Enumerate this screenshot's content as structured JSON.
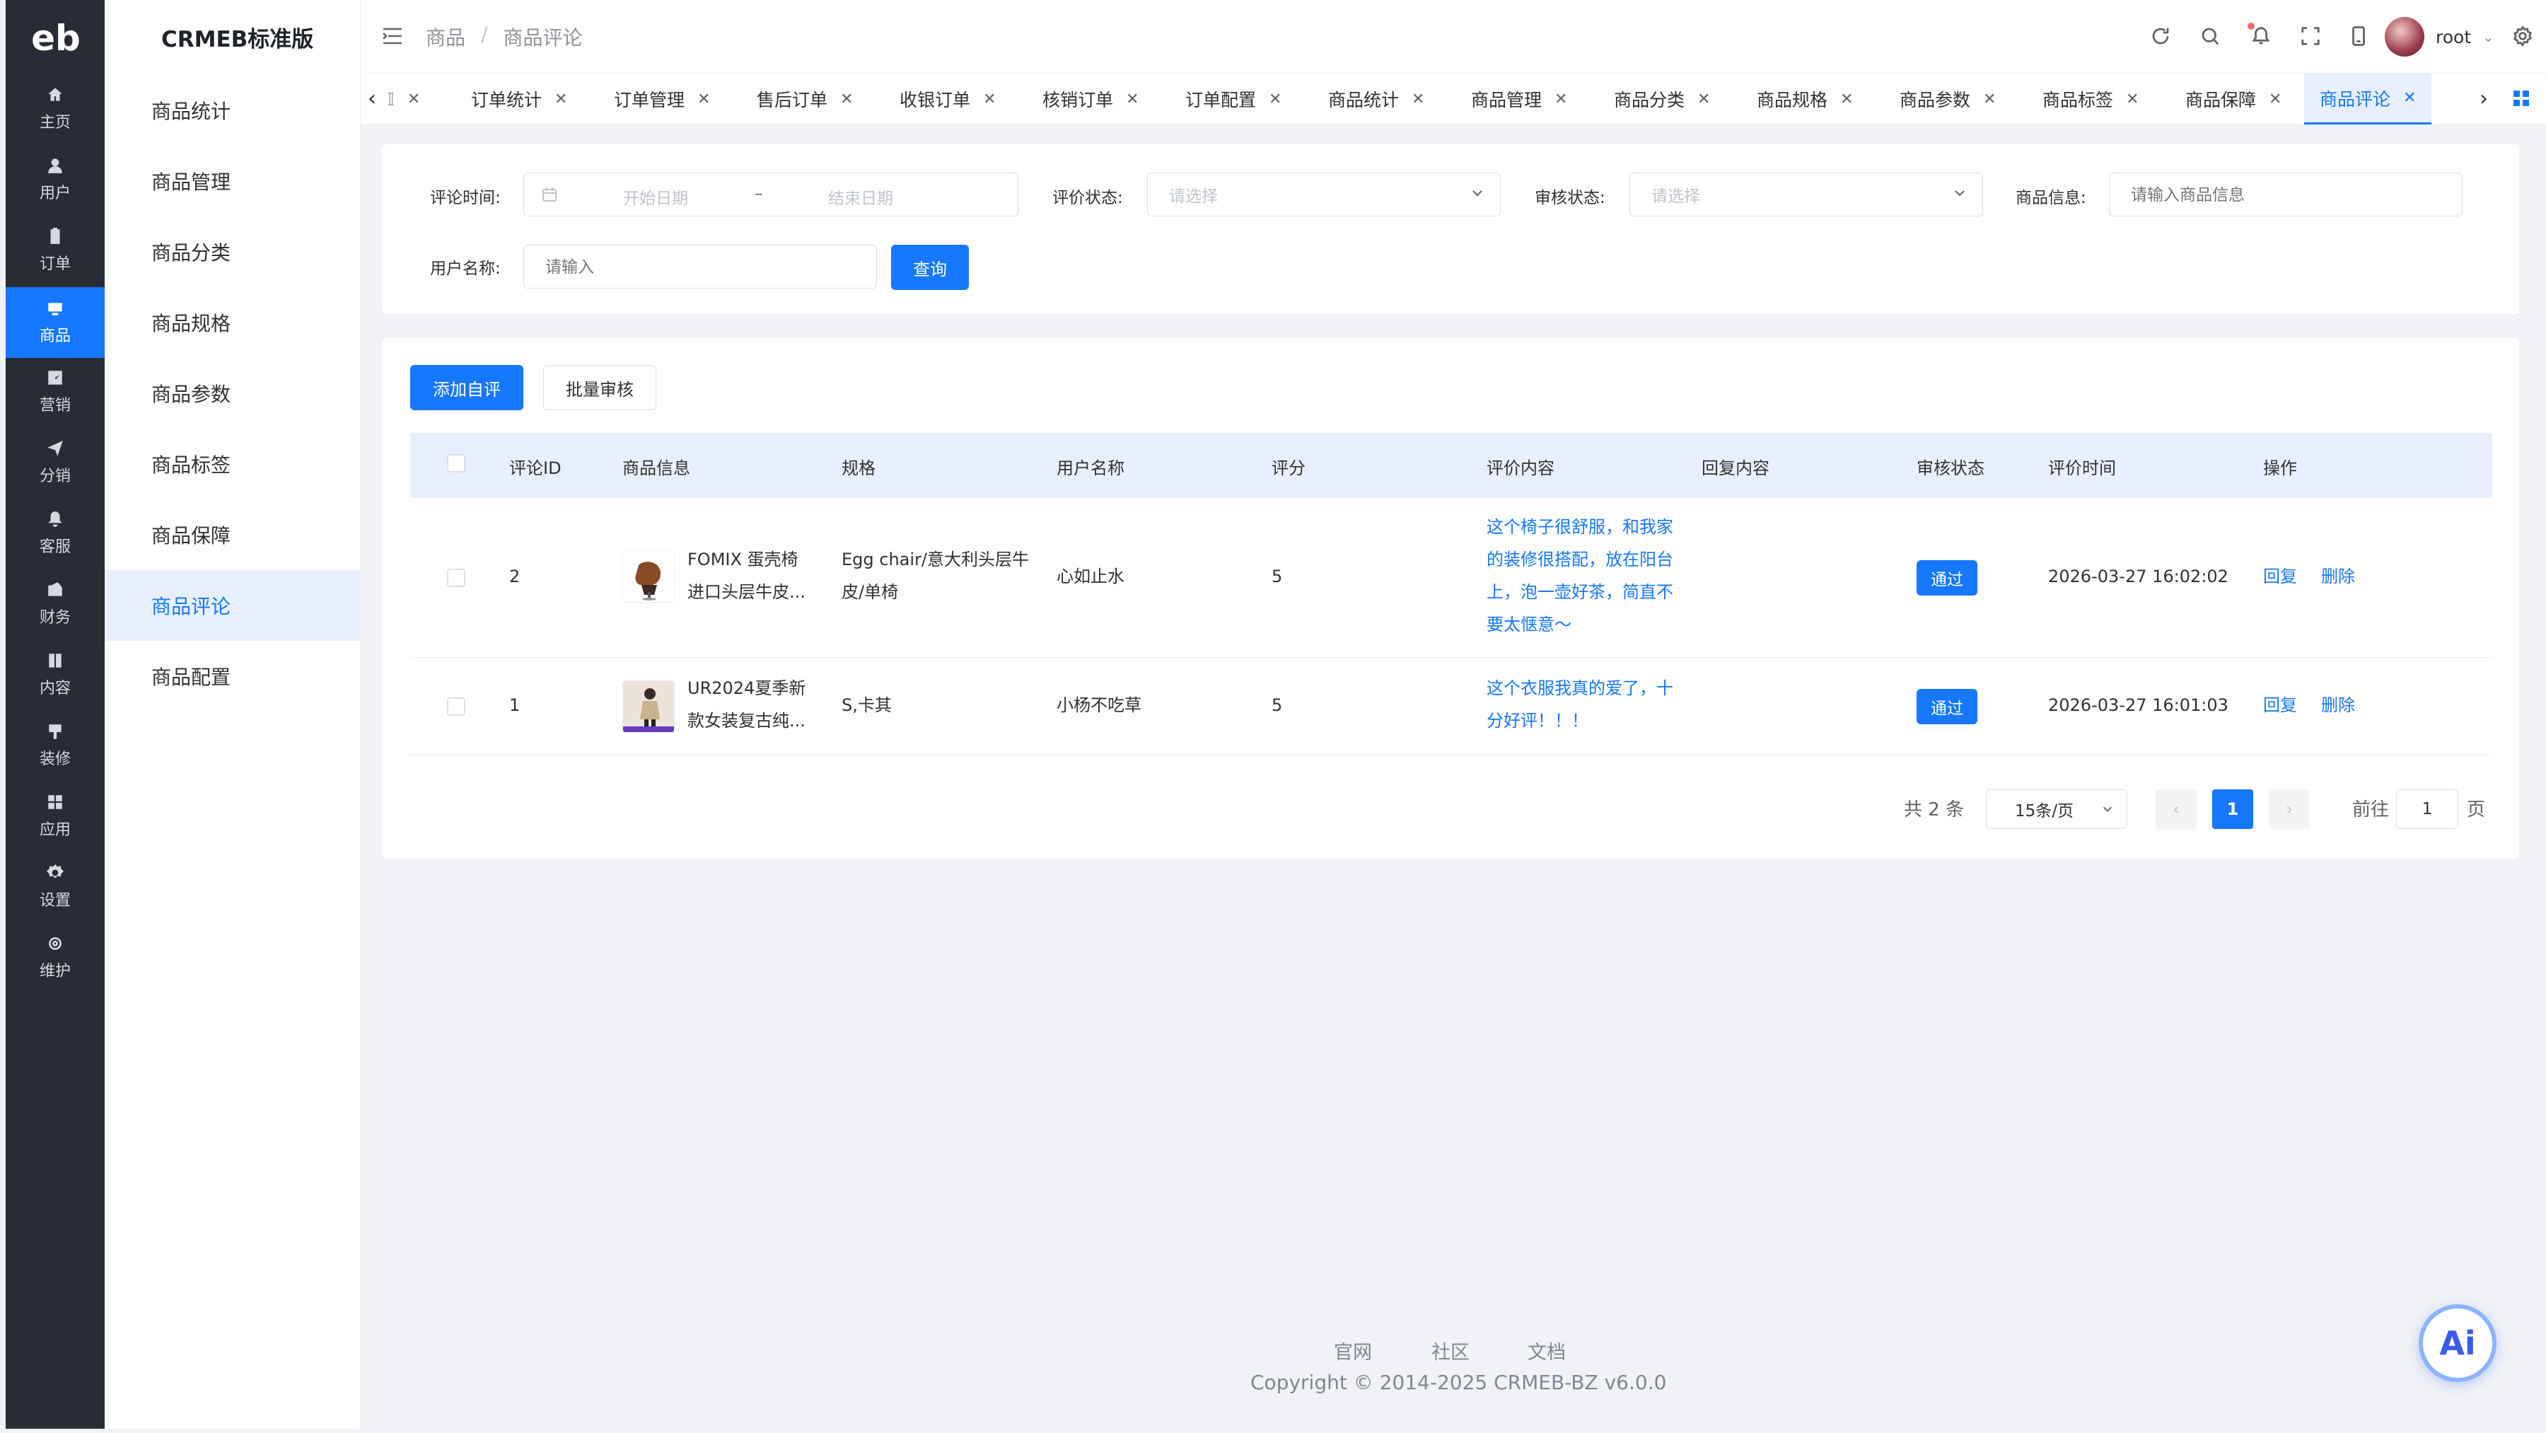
{
  "brand": {
    "logo_text": "eb",
    "title": "CRMEB标准版"
  },
  "rail": [
    {
      "label": "主页",
      "icon": "home-icon"
    },
    {
      "label": "用户",
      "icon": "user-icon"
    },
    {
      "label": "订单",
      "icon": "clipboard-icon"
    },
    {
      "label": "商品",
      "icon": "product-icon",
      "active": true
    },
    {
      "label": "营销",
      "icon": "chart-icon"
    },
    {
      "label": "分销",
      "icon": "send-icon"
    },
    {
      "label": "客服",
      "icon": "bell-icon"
    },
    {
      "label": "财务",
      "icon": "wallet-icon"
    },
    {
      "label": "内容",
      "icon": "book-icon"
    },
    {
      "label": "装修",
      "icon": "brush-icon"
    },
    {
      "label": "应用",
      "icon": "grid-icon"
    },
    {
      "label": "设置",
      "icon": "gear-icon"
    },
    {
      "label": "维护",
      "icon": "cog-icon"
    }
  ],
  "subnav": [
    {
      "label": "商品统计"
    },
    {
      "label": "商品管理"
    },
    {
      "label": "商品分类"
    },
    {
      "label": "商品规格"
    },
    {
      "label": "商品参数"
    },
    {
      "label": "商品标签"
    },
    {
      "label": "商品保障"
    },
    {
      "label": "商品评论",
      "active": true
    },
    {
      "label": "商品配置"
    }
  ],
  "breadcrumb": {
    "parent": "商品",
    "separator": "/",
    "current": "商品评论"
  },
  "header_user": {
    "name": "root"
  },
  "tabs": [
    {
      "label": "订单统计"
    },
    {
      "label": "订单管理"
    },
    {
      "label": "售后订单"
    },
    {
      "label": "收银订单"
    },
    {
      "label": "核销订单"
    },
    {
      "label": "订单配置"
    },
    {
      "label": "商品统计"
    },
    {
      "label": "商品管理"
    },
    {
      "label": "商品分类"
    },
    {
      "label": "商品规格"
    },
    {
      "label": "商品参数"
    },
    {
      "label": "商品标签"
    },
    {
      "label": "商品保障"
    },
    {
      "label": "商品评论",
      "active": true
    }
  ],
  "filters": {
    "time_label": "评论时间:",
    "start_placeholder": "开始日期",
    "range_sep": "–",
    "end_placeholder": "结束日期",
    "review_status_label": "评价状态:",
    "review_status_placeholder": "请选择",
    "audit_status_label": "审核状态:",
    "audit_status_placeholder": "请选择",
    "product_label": "商品信息:",
    "product_placeholder": "请输入商品信息",
    "user_label": "用户名称:",
    "user_placeholder": "请输入",
    "query_button": "查询"
  },
  "actions": {
    "add_button": "添加自评",
    "batch_button": "批量审核"
  },
  "table": {
    "columns": [
      "评论ID",
      "商品信息",
      "规格",
      "用户名称",
      "评分",
      "评价内容",
      "回复内容",
      "审核状态",
      "评价时间",
      "操作"
    ],
    "rows": [
      {
        "id": "2",
        "product_line1": "FOMIX 蛋壳椅",
        "product_line2": "进口头层牛皮...",
        "spec_line1": "Egg chair/意大利头层牛",
        "spec_line2": "皮/单椅",
        "user": "心如止水",
        "score": "5",
        "review": [
          "这个椅子很舒服，和我家",
          "的装修很搭配，放在阳台",
          "上，泡一壶好茶，简直不",
          "要太惬意～"
        ],
        "reply": "",
        "status": "通过",
        "time": "2026-03-27 16:02:02",
        "op_reply": "回复",
        "op_delete": "删除"
      },
      {
        "id": "1",
        "product_line1": "UR2024夏季新",
        "product_line2": "款女装复古纯...",
        "spec_line1": "S,卡其",
        "spec_line2": "",
        "user": "小杨不吃草",
        "score": "5",
        "review": [
          "这个衣服我真的爱了，十",
          "分好评！！！"
        ],
        "reply": "",
        "status": "通过",
        "time": "2026-03-27 16:01:03",
        "op_reply": "回复",
        "op_delete": "删除"
      }
    ]
  },
  "pagination": {
    "total": "共 2 条",
    "page_size": "15条/页",
    "prev": "‹",
    "current": "1",
    "next": "›",
    "goto_label": "前往",
    "goto_value": "1",
    "page_unit": "页"
  },
  "footer": {
    "links": [
      "官网",
      "社区",
      "文档"
    ],
    "copyright": "Copyright © 2014-2025 CRMEB-BZ v6.0.0"
  },
  "ai_button": "Ai",
  "colors": {
    "accent": "#1677ff",
    "sidebar": "#282c34",
    "header_row": "#e8f0ff"
  }
}
